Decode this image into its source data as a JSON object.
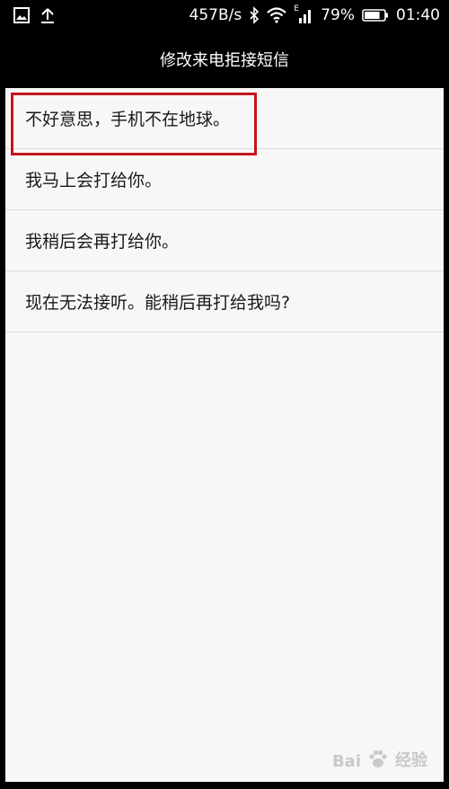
{
  "status_bar": {
    "network_speed": "457B/s",
    "network_type": "E",
    "battery_percent": "79%",
    "time": "01:40",
    "battery_level": 0.79,
    "icons": [
      "gallery-icon",
      "upload-icon",
      "bluetooth-icon",
      "wifi-icon",
      "signal-icon",
      "battery-icon"
    ]
  },
  "title_bar": {
    "title": "修改来电拒接短信"
  },
  "messages": [
    {
      "text": "不好意思，手机不在地球。",
      "highlighted": true
    },
    {
      "text": "我马上会打给你。",
      "highlighted": false
    },
    {
      "text": "我稍后会再打给你。",
      "highlighted": false
    },
    {
      "text": "现在无法接听。能稍后再打给我吗?",
      "highlighted": false
    }
  ],
  "watermark": {
    "text": "Bai",
    "suffix": "经验"
  },
  "colors": {
    "highlight_border": "#c4161c",
    "background": "#f7f7f7",
    "bar": "#000000"
  }
}
